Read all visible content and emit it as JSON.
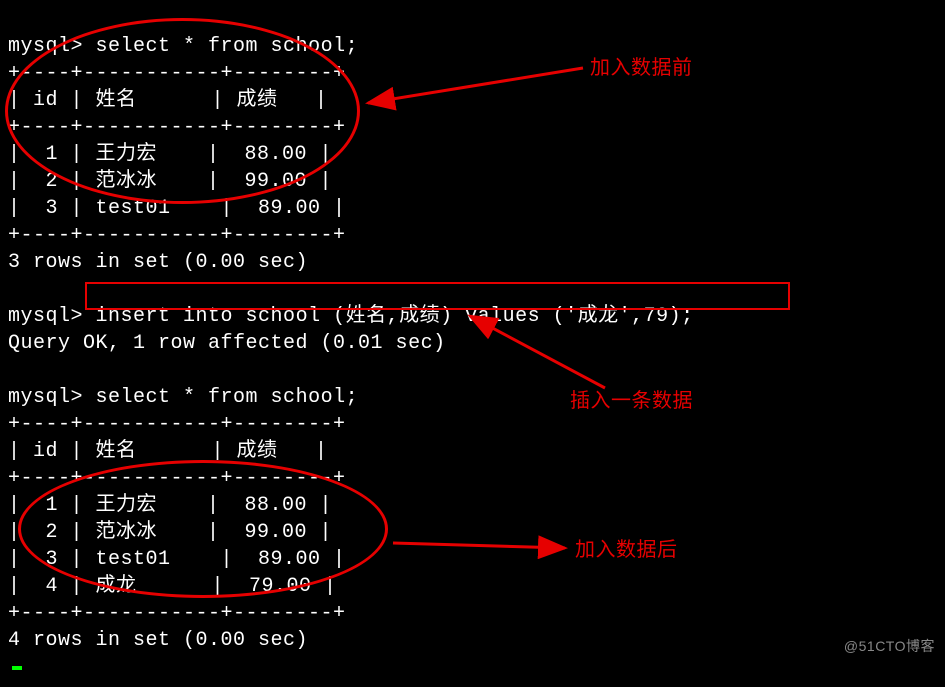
{
  "prompt": "mysql>",
  "query_select": "select * from school;",
  "table_before": {
    "sep_top": "+----+-----------+--------+",
    "header": "| id | 姓名      | 成绩   |",
    "sep_mid": "+----+-----------+--------+",
    "rows": [
      "|  1 | 王力宏    |  88.00 |",
      "|  2 | 范冰冰    |  99.00 |",
      "|  3 | test01    |  89.00 |"
    ],
    "sep_bot": "+----+-----------+--------+",
    "footer": "3 rows in set (0.00 sec)"
  },
  "insert_stmt": "insert into school (姓名,成绩) values ('成龙',79);",
  "insert_result": "Query OK, 1 row affected (0.01 sec)",
  "table_after": {
    "sep_top": "+----+-----------+--------+",
    "header": "| id | 姓名      | 成绩   |",
    "sep_mid": "+----+-----------+--------+",
    "rows": [
      "|  1 | 王力宏    |  88.00 |",
      "|  2 | 范冰冰    |  99.00 |",
      "|  3 | test01    |  89.00 |",
      "|  4 | 成龙      |  79.00 |"
    ],
    "sep_bot": "+----+-----------+--------+",
    "footer": "4 rows in set (0.00 sec)"
  },
  "annotations": {
    "before": "加入数据前",
    "insert": "插入一条数据",
    "after": "加入数据后"
  },
  "watermark": "@51CTO博客"
}
